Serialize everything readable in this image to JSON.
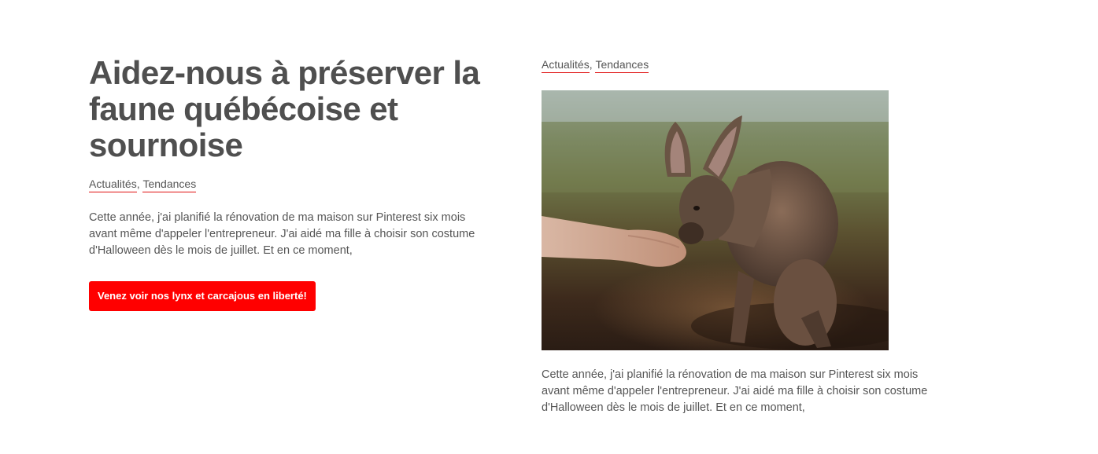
{
  "article_left": {
    "title": "Aidez-nous à préserver la faune québécoise et sournoise",
    "categories": [
      "Actualités",
      "Tendances"
    ],
    "category_separator": ",",
    "excerpt": "Cette année, j'ai planifié la rénovation de ma maison sur Pinterest six mois avant même d'appeler l'entrepreneur. J'ai aidé ma fille à choisir son costume d'Halloween dès le mois de juillet. Et en ce moment,",
    "cta_label": "Venez voir nos lynx et carcajous en liberté!"
  },
  "article_right": {
    "categories": [
      "Actualités",
      "Tendances"
    ],
    "category_separator": ",",
    "image_subject": "wallaby-eating-from-hand-photo",
    "excerpt": "Cette année, j'ai planifié la rénovation de ma maison sur Pinterest six mois avant même d'appeler l'entrepreneur. J'ai aidé ma fille à choisir son costume d'Halloween dès le mois de juillet. Et en ce moment,"
  },
  "colors": {
    "accent": "#ff0000",
    "underline": "#e01010",
    "heading": "#4f4f4f",
    "text": "#555555",
    "background": "#ffffff"
  }
}
